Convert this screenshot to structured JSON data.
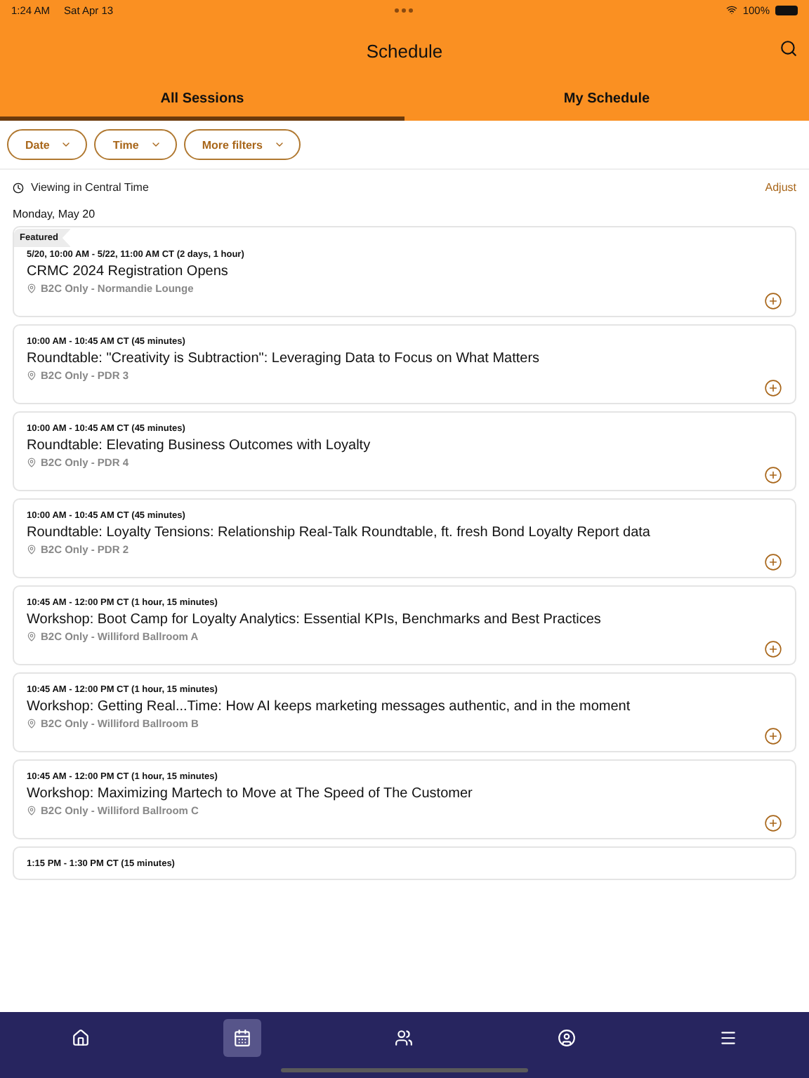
{
  "status_bar": {
    "time": "1:24 AM",
    "date": "Sat Apr 13",
    "battery": "100%"
  },
  "header": {
    "title": "Schedule"
  },
  "tabs": [
    {
      "label": "All Sessions",
      "selected": true
    },
    {
      "label": "My Schedule",
      "selected": false
    }
  ],
  "filters": [
    "Date",
    "Time",
    "More filters"
  ],
  "timezone": {
    "label": "Viewing in Central Time",
    "action": "Adjust"
  },
  "day": "Monday, May 20",
  "sessions": [
    {
      "badge": "Featured",
      "time": "5/20, 10:00 AM - 5/22, 11:00 AM CT (2 days, 1 hour)",
      "title": "CRMC 2024 Registration Opens",
      "location": "B2C Only - Normandie Lounge"
    },
    {
      "time": "10:00 AM - 10:45 AM CT (45 minutes)",
      "title": "Roundtable: \"Creativity is Subtraction\": Leveraging Data to Focus on What Matters",
      "location": "B2C Only - PDR 3"
    },
    {
      "time": "10:00 AM - 10:45 AM CT (45 minutes)",
      "title": "Roundtable: Elevating Business Outcomes with Loyalty",
      "location": "B2C Only - PDR 4"
    },
    {
      "time": "10:00 AM - 10:45 AM CT (45 minutes)",
      "title": "Roundtable: Loyalty Tensions: Relationship Real-Talk Roundtable, ft. fresh Bond Loyalty Report data",
      "location": "B2C Only - PDR 2"
    },
    {
      "time": "10:45 AM - 12:00 PM CT (1 hour, 15 minutes)",
      "title": "Workshop: Boot Camp for Loyalty Analytics: Essential KPIs, Benchmarks and Best Practices",
      "location": "B2C Only - Williford Ballroom A"
    },
    {
      "time": "10:45 AM - 12:00 PM CT (1 hour, 15 minutes)",
      "title": "Workshop: Getting Real...Time: How AI keeps marketing messages authentic, and in the moment",
      "location": "B2C Only - Williford Ballroom B"
    },
    {
      "time": "10:45 AM - 12:00 PM CT (1 hour, 15 minutes)",
      "title": "Workshop: Maximizing Martech to Move at The Speed of The Customer",
      "location": "B2C Only - Williford Ballroom C"
    },
    {
      "time": "1:15 PM - 1:30 PM CT (15 minutes)"
    }
  ],
  "nav": [
    {
      "kind": "home",
      "selected": false
    },
    {
      "kind": "calendar",
      "selected": true
    },
    {
      "kind": "people",
      "selected": false
    },
    {
      "kind": "profile",
      "selected": false
    },
    {
      "kind": "menu",
      "selected": false
    }
  ]
}
